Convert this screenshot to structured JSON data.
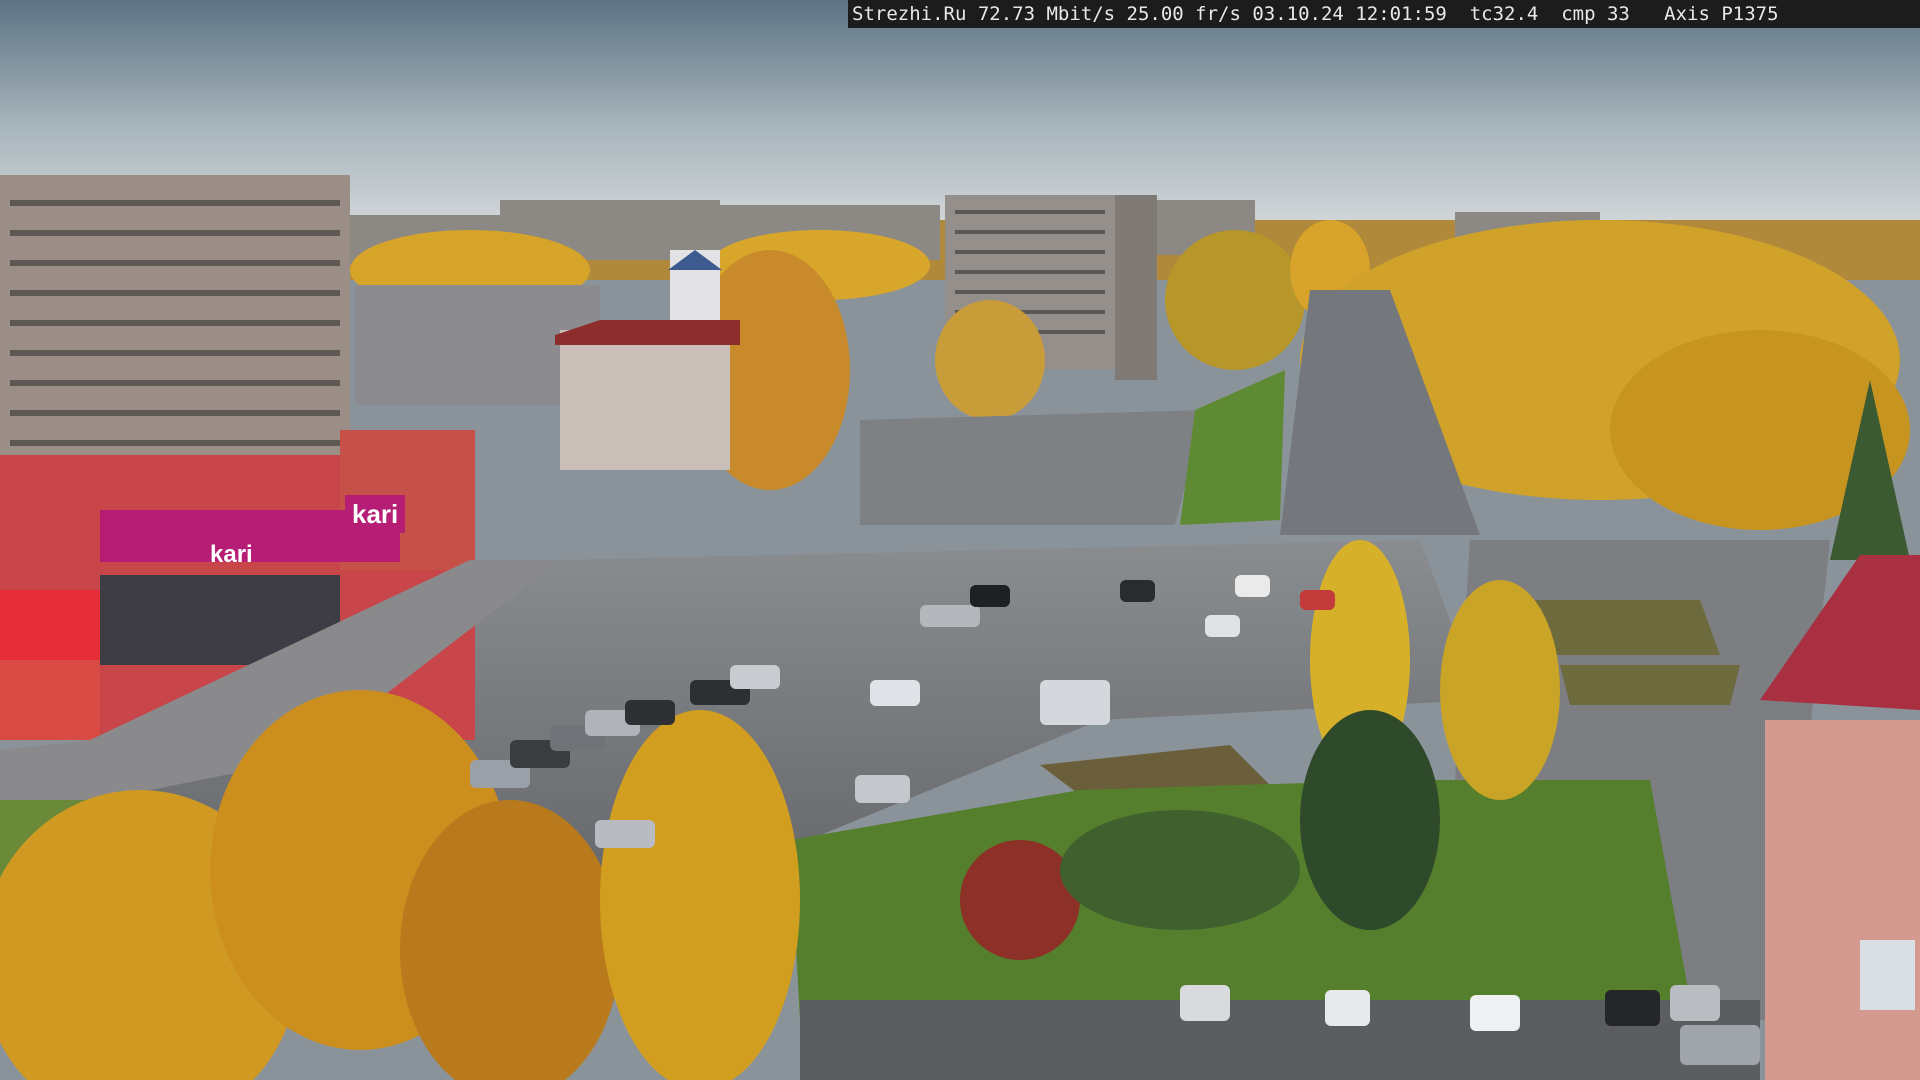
{
  "overlay": {
    "text": "Strezhi.Ru 72.73 Mbit/s 25.00 fr/s 03.10.24 12:01:59  tc32.4  cmp 33   Axis P1375"
  },
  "signs": {
    "store_logo": "kari",
    "store_logo_small": "kari"
  },
  "colors": {
    "sky_top": "#5f7688",
    "sky_horizon": "#d8dde0",
    "foliage_yellow": "#d9a21e",
    "foliage_orange": "#c47a1c",
    "grass": "#5f8a34",
    "asphalt": "#6a6c70",
    "store_red": "#c8464a",
    "store_magenta": "#b51e74"
  }
}
